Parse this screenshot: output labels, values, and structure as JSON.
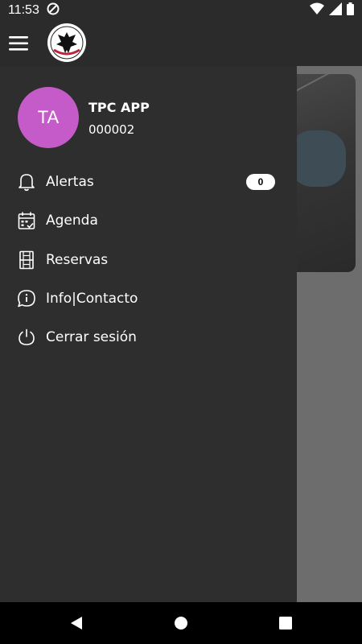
{
  "status_bar": {
    "time": "11:53",
    "icons": [
      "sync-icon",
      "wifi-icon",
      "signal-icon",
      "battery-icon"
    ]
  },
  "app_bar": {
    "menu_icon": "hamburger-menu-icon",
    "logo_icon": "eagle-club-logo"
  },
  "user": {
    "initials": "TA",
    "name": "TPC APP",
    "id": "000002",
    "avatar_color": "#c55bc8"
  },
  "menu": {
    "items": [
      {
        "label": "Alertas",
        "icon": "bell-icon",
        "badge": "0"
      },
      {
        "label": "Agenda",
        "icon": "calendar-icon"
      },
      {
        "label": "Reservas",
        "icon": "court-icon"
      },
      {
        "label": "Info|Contacto",
        "icon": "info-chat-icon"
      },
      {
        "label": "Cerrar sesión",
        "icon": "power-icon"
      }
    ]
  },
  "nav_bar": {
    "buttons": [
      "back-triangle-icon",
      "home-circle-icon",
      "recents-square-icon"
    ]
  }
}
